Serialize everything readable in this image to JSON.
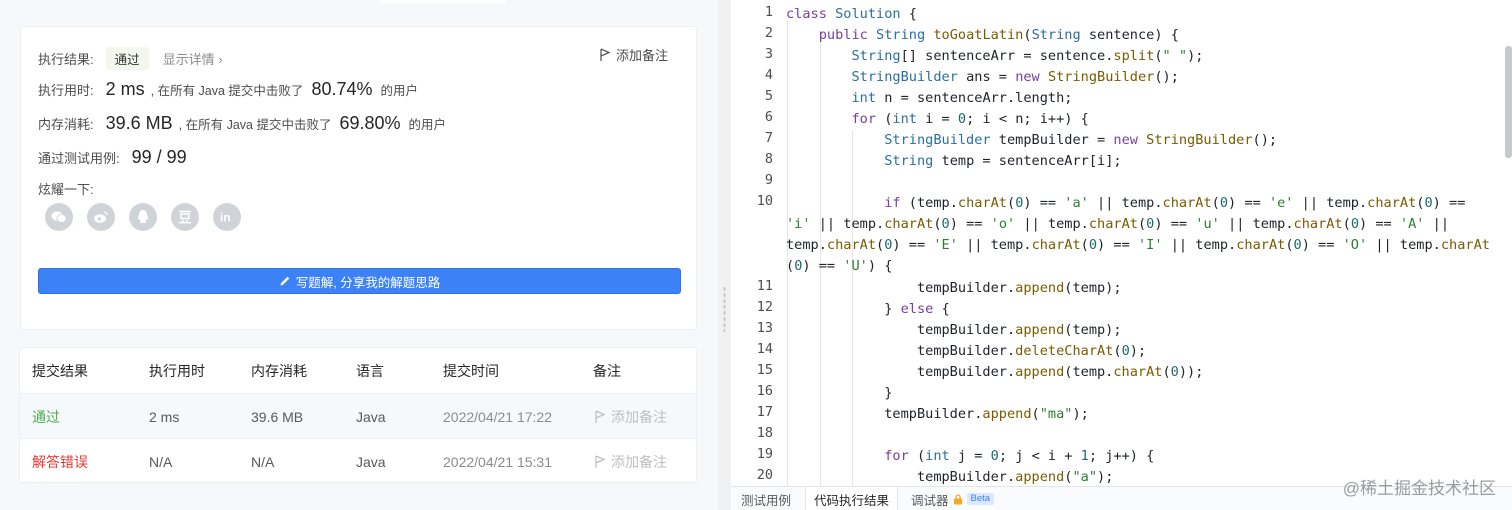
{
  "result": {
    "label": "执行结果:",
    "status": "通过",
    "detail_link": "显示详情 ›",
    "add_note": "添加备注",
    "runtime": {
      "label": "执行用时:",
      "value": "2 ms",
      "mid": ", 在所有 Java 提交中击败了",
      "pct": "80.74%",
      "tail": "的用户"
    },
    "memory": {
      "label": "内存消耗:",
      "value": "39.6 MB",
      "mid": ", 在所有 Java 提交中击败了",
      "pct": "69.80%",
      "tail": "的用户"
    },
    "tests": {
      "label": "通过测试用例:",
      "value": "99 / 99"
    },
    "share_label": "炫耀一下:",
    "share_icons": [
      "wechat-icon",
      "weibo-icon",
      "qq-icon",
      "douban-icon",
      "linkedin-icon"
    ],
    "write_button": "写题解, 分享我的解题思路"
  },
  "submissions": {
    "headers": [
      "提交结果",
      "执行用时",
      "内存消耗",
      "语言",
      "提交时间",
      "备注"
    ],
    "rows": [
      {
        "status": "通过",
        "runtime": "2 ms",
        "memory": "39.6 MB",
        "lang": "Java",
        "time": "2022/04/21 17:22",
        "note": "添加备注"
      },
      {
        "status": "解答错误",
        "runtime": "N/A",
        "memory": "N/A",
        "lang": "Java",
        "time": "2022/04/21 15:31",
        "note": "添加备注"
      }
    ]
  },
  "editor": {
    "line_numbers": [
      "1",
      "2",
      "3",
      "4",
      "5",
      "6",
      "7",
      "8",
      "9",
      "10",
      "11",
      "12",
      "13",
      "14",
      "15",
      "16",
      "17",
      "18",
      "19",
      "20"
    ]
  },
  "bottom_tabs": [
    "测试用例",
    "代码执行结果",
    "调试器",
    "Beta"
  ],
  "watermark": "@稀土掘金技术社区",
  "colors": {
    "accent": "#3c82f6",
    "pass": "#4caf50",
    "error": "#e53935"
  }
}
